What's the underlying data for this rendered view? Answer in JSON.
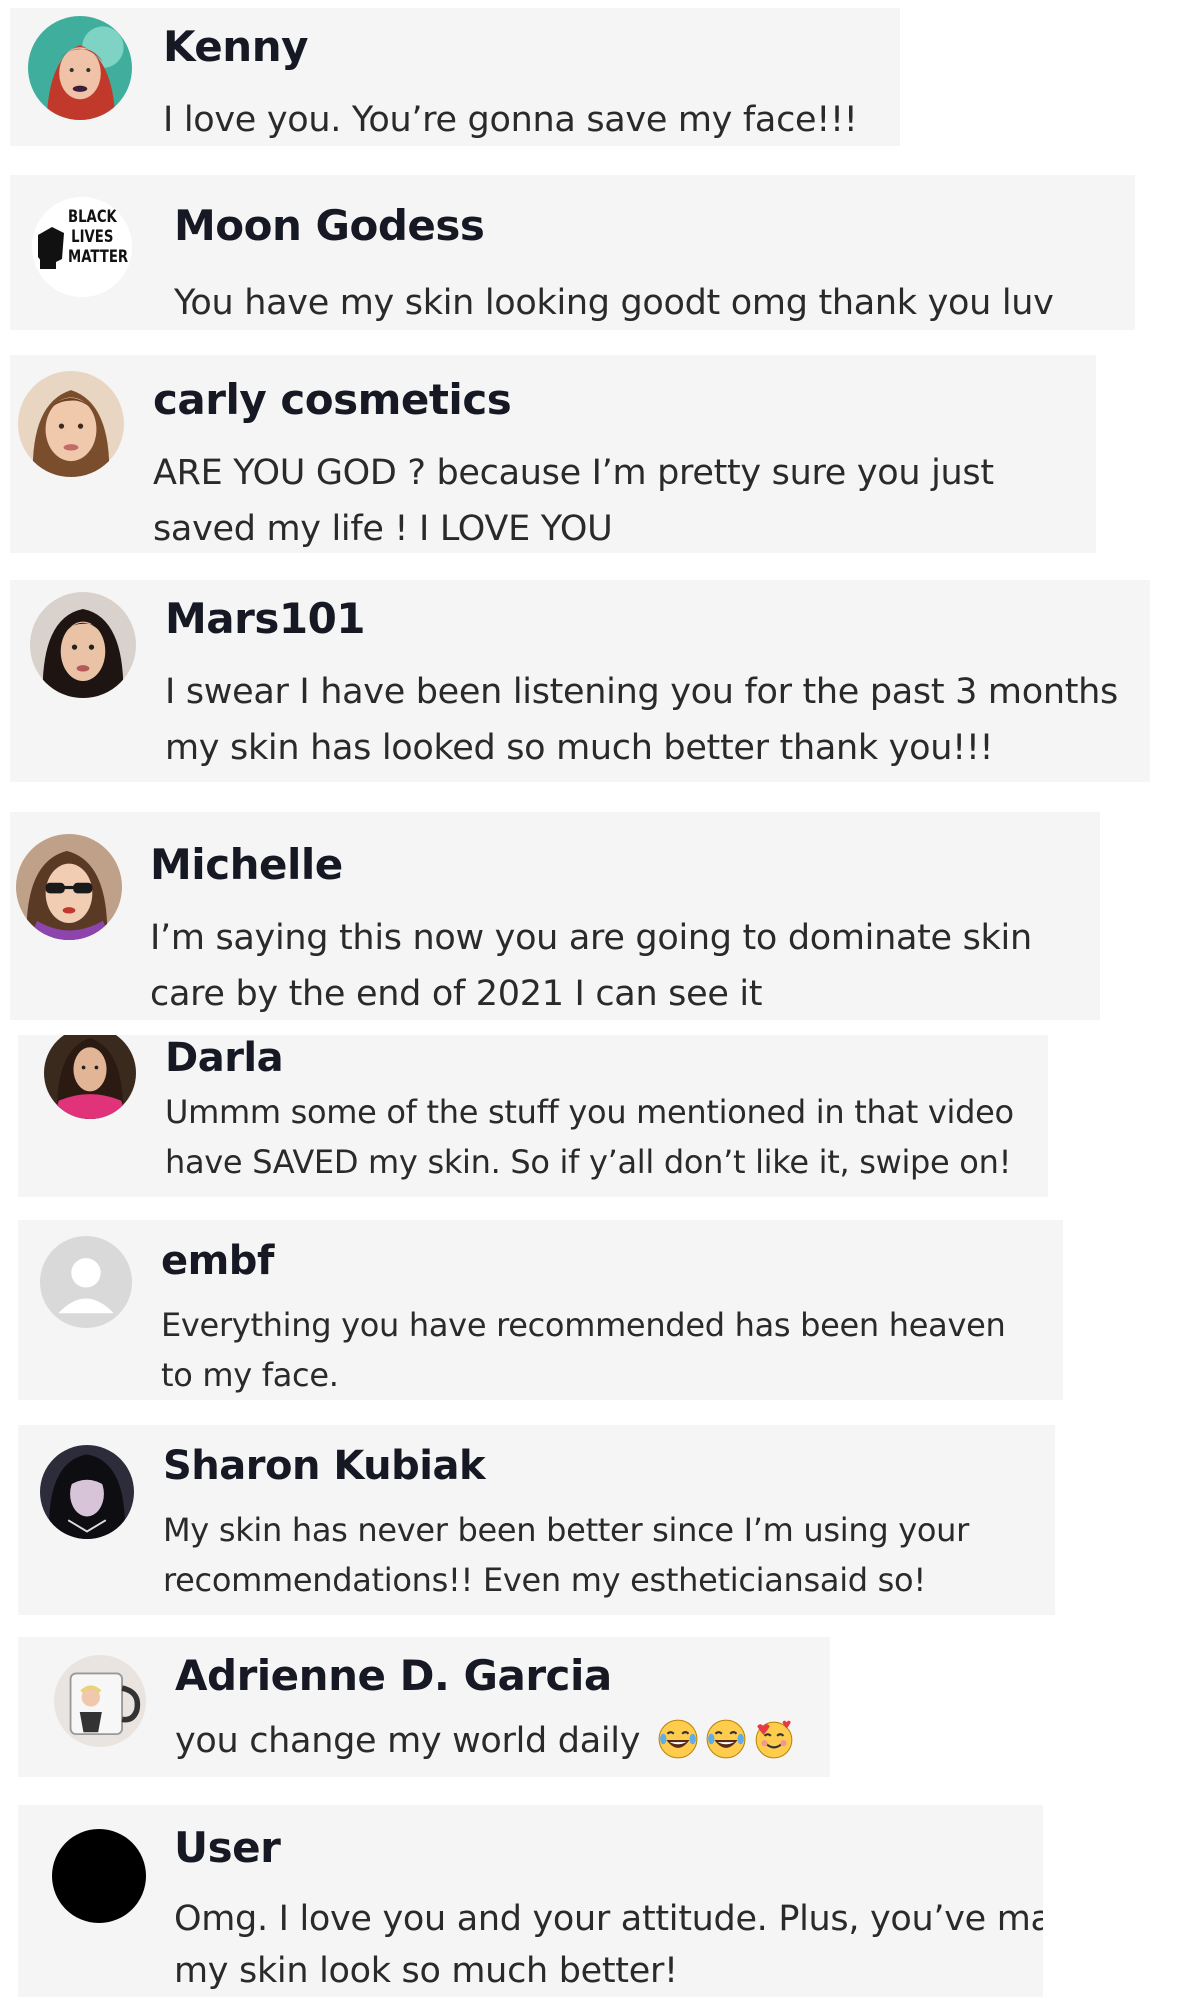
{
  "comments": [
    {
      "name": "Kenny",
      "lines": [
        "I love you. You’re gonna save my face!!!"
      ],
      "avatar": "woman-dark-lips-avatar"
    },
    {
      "name": "Moon Godess",
      "lines": [
        "You have my skin looking goodt omg thank you luv"
      ],
      "avatar": "black-lives-matter-avatar",
      "avatar_text": [
        "BLACK",
        "LIVES",
        "MATTER"
      ]
    },
    {
      "name": "carly cosmetics",
      "lines": [
        "ARE YOU GOD ? because I’m pretty sure you just",
        "saved my life ! I LOVE YOU"
      ],
      "avatar": "woman-brown-hair-avatar"
    },
    {
      "name": "Mars101",
      "lines": [
        "I swear I have been listening you for the past 3 months",
        "my skin has looked so much better thank you!!!"
      ],
      "avatar": "woman-dark-hair-avatar"
    },
    {
      "name": "Michelle",
      "lines": [
        "I’m saying this now you are going to dominate skin",
        "care by the end of 2021 I can see it"
      ],
      "avatar": "woman-sunglasses-avatar"
    },
    {
      "name": "Darla",
      "lines": [
        "Ummm some of the stuff you mentioned in that video",
        "have SAVED my skin. So if y’all don’t like it, swipe on!"
      ],
      "avatar": "woman-pink-top-avatar"
    },
    {
      "name": "embf",
      "lines": [
        "Everything you have recommended has been heaven",
        "to my face."
      ],
      "avatar": "default-user-avatar"
    },
    {
      "name": "Sharon Kubiak",
      "lines": [
        "My skin has never been better since I’m using your",
        "recommendations!! Even my estheticiansaid so!"
      ],
      "avatar": "woman-black-hair-avatar"
    },
    {
      "name": "Adrienne D. Garcia",
      "lines": [
        "you change my world daily"
      ],
      "emojis": [
        "laughing-tears-emoji",
        "laughing-tears-emoji",
        "smiling-hearts-emoji"
      ],
      "avatar": "mug-avatar"
    },
    {
      "name": "User",
      "lines": [
        "Omg. I love you and your attitude. Plus, you’ve made",
        "my skin look so much better!"
      ],
      "avatar": "black-circle-avatar"
    }
  ]
}
